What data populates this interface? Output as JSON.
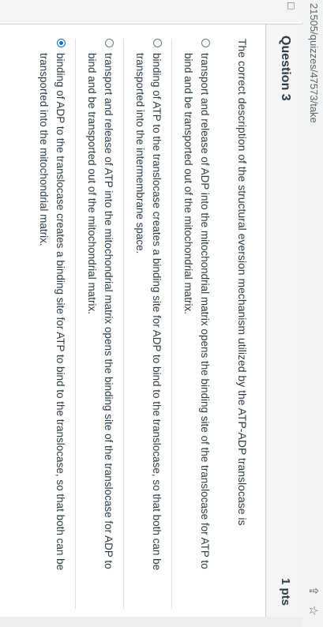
{
  "browser": {
    "url": "21505/quizzes/47573/take",
    "icons": {
      "share": "⇪",
      "bookmark": "☆"
    }
  },
  "sidebar": {
    "icon": "□"
  },
  "question": {
    "title": "Question 3",
    "points": "1 pts",
    "text": "The correct description of the structural eversion mechanism utilized by the ATP-ADP translocase is",
    "answers": [
      {
        "text": "transport and release of ADP into the mitochondrial matrix opens the binding site of the translocase for ATP to bind and be transported out of the mitochondrial matrix.",
        "selected": false
      },
      {
        "text": "binding of ATP to the translocase creates a binding site for ADP to bind to the translocase, so that both can be transported into the intermembrane space.",
        "selected": false
      },
      {
        "text": "transport and release of ATP into the mitochondrial matrix opens the binding site of the translocase for ADP to bind and be transported out of the mitochondrial matrix.",
        "selected": false
      },
      {
        "text": "binding of ADP to the translocase creates a binding site for ATP to bind to the translocase, so that both can be transported into the mitochondrial matrix.",
        "selected": true
      }
    ]
  }
}
